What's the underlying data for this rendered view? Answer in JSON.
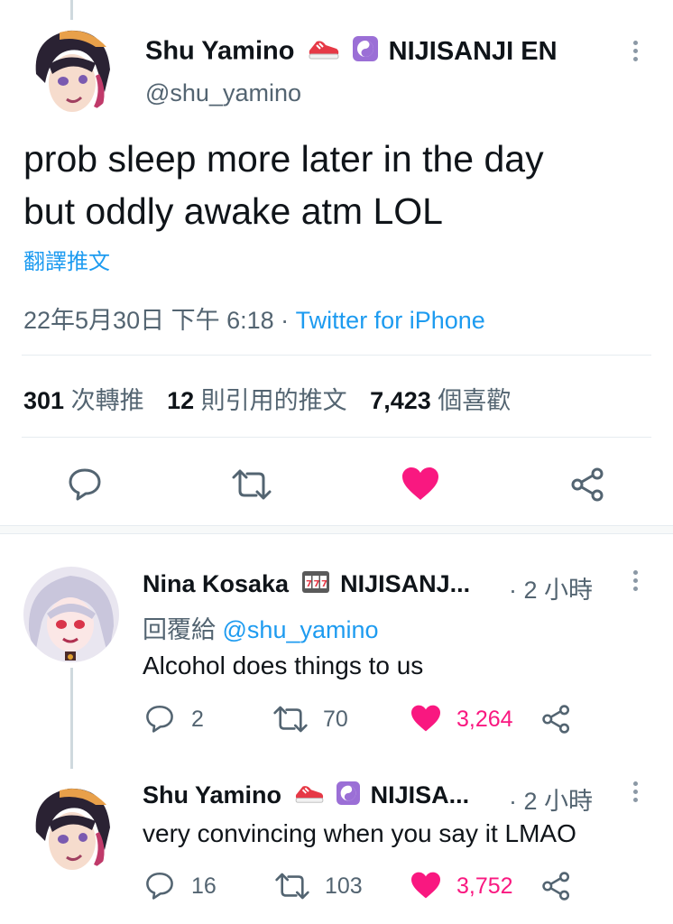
{
  "main_tweet": {
    "display_name": "Shu Yamino",
    "org": "NIJISANJI EN",
    "handle": "@shu_yamino",
    "text_line1": "prob sleep more later in the day",
    "text_line2": "but oddly awake atm LOL",
    "translate": "翻譯推文",
    "timestamp": "22年5月30日 下午 6:18",
    "separator": "·",
    "source": "Twitter for iPhone",
    "stats": {
      "retweets_count": "301",
      "retweets_label": "次轉推",
      "quotes_count": "12",
      "quotes_label": "則引用的推文",
      "likes_count": "7,423",
      "likes_label": "個喜歡"
    }
  },
  "replies": [
    {
      "display_name": "Nina Kosaka",
      "org": "NIJISANJ...",
      "time": "· 2 小時",
      "reply_to_label": "回覆給",
      "reply_to_handle": "@shu_yamino",
      "text": "Alcohol does things to us",
      "reply_count": "2",
      "retweet_count": "70",
      "like_count": "3,264"
    },
    {
      "display_name": "Shu Yamino",
      "org": "NIJISA...",
      "time": "· 2 小時",
      "text": "very convincing when you say it LMAO",
      "reply_count": "16",
      "retweet_count": "103",
      "like_count": "3,752"
    }
  ],
  "colors": {
    "accent": "#1d9bf0",
    "like": "#f91880",
    "text": "#0f1419",
    "secondary": "#536471"
  },
  "icons": [
    "sneaker-emoji",
    "yin-yang-emoji",
    "slot-machine-emoji",
    "more-icon",
    "reply-icon",
    "retweet-icon",
    "heart-icon",
    "share-icon"
  ]
}
